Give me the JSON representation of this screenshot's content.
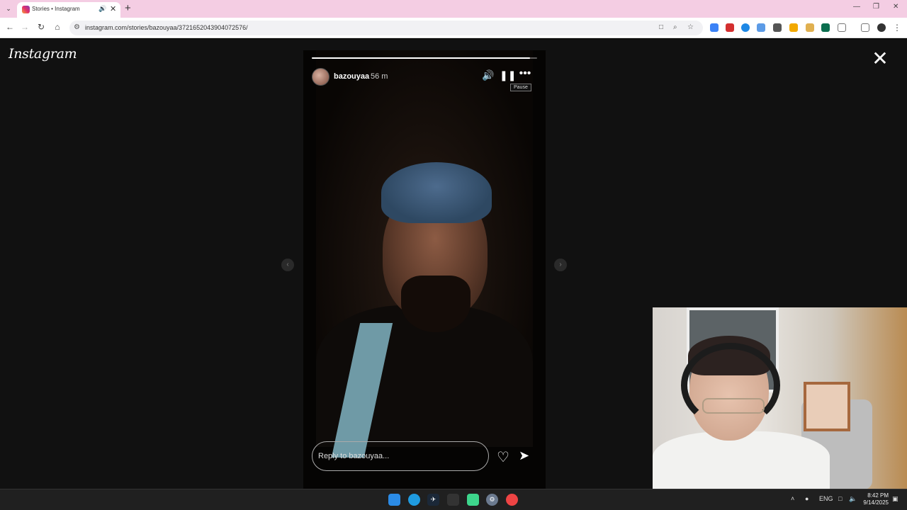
{
  "browser": {
    "tab": {
      "title": "Stories • Instagram"
    },
    "url": "instagram.com/stories/bazouyaa/3721652043904072576/"
  },
  "page": {
    "logo": "Instagram",
    "story": {
      "username": "bazouyaa",
      "age": "56 m",
      "progress": 0.97,
      "tooltip": "Pause",
      "reply_placeholder": "Reply to bazouyaa..."
    }
  },
  "taskbar": {
    "language": "ENG",
    "time": "8:42 PM",
    "date": "9/14/2025"
  },
  "icons": {
    "close": "close-icon",
    "volume": "volume-icon",
    "pause": "pause-icon",
    "more": "more-icon",
    "heart": "heart-icon",
    "send": "send-icon"
  },
  "colors": {
    "tabstrip": "#f4cde3",
    "page_bg": "#111111",
    "taskbar": "#202020"
  }
}
